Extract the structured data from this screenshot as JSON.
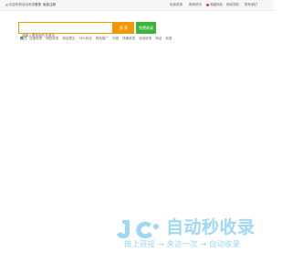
{
  "topbar": {
    "welcome": "欢迎来到自动收录",
    "login": "登录",
    "register": "免费注册",
    "links": [
      {
        "label": "免费收录"
      },
      {
        "label": "新闻资讯"
      },
      {
        "label": "收藏网站"
      },
      {
        "label": "网站导航"
      },
      {
        "label": "联系我们"
      }
    ],
    "colors": {
      "accent": "#f39800",
      "green": "#3cb43c",
      "red": "#e03c3c"
    }
  },
  "search": {
    "placeholder": "请输入要搜索的关键词",
    "search_button": "搜 索",
    "submit_button": "免费收录"
  },
  "hotwords": {
    "label": "热门",
    "items": [
      "百度收录",
      "网站收录",
      "网站提交",
      "SEO优化",
      "网站推广",
      "外链",
      "快速收录",
      "自动收录",
      "网站",
      "收录"
    ]
  },
  "logo": {
    "title": "自动秒收录",
    "slogan": "做上链接 → 来访一次 → 自动收录",
    "icon": "jc-logo-icon"
  }
}
